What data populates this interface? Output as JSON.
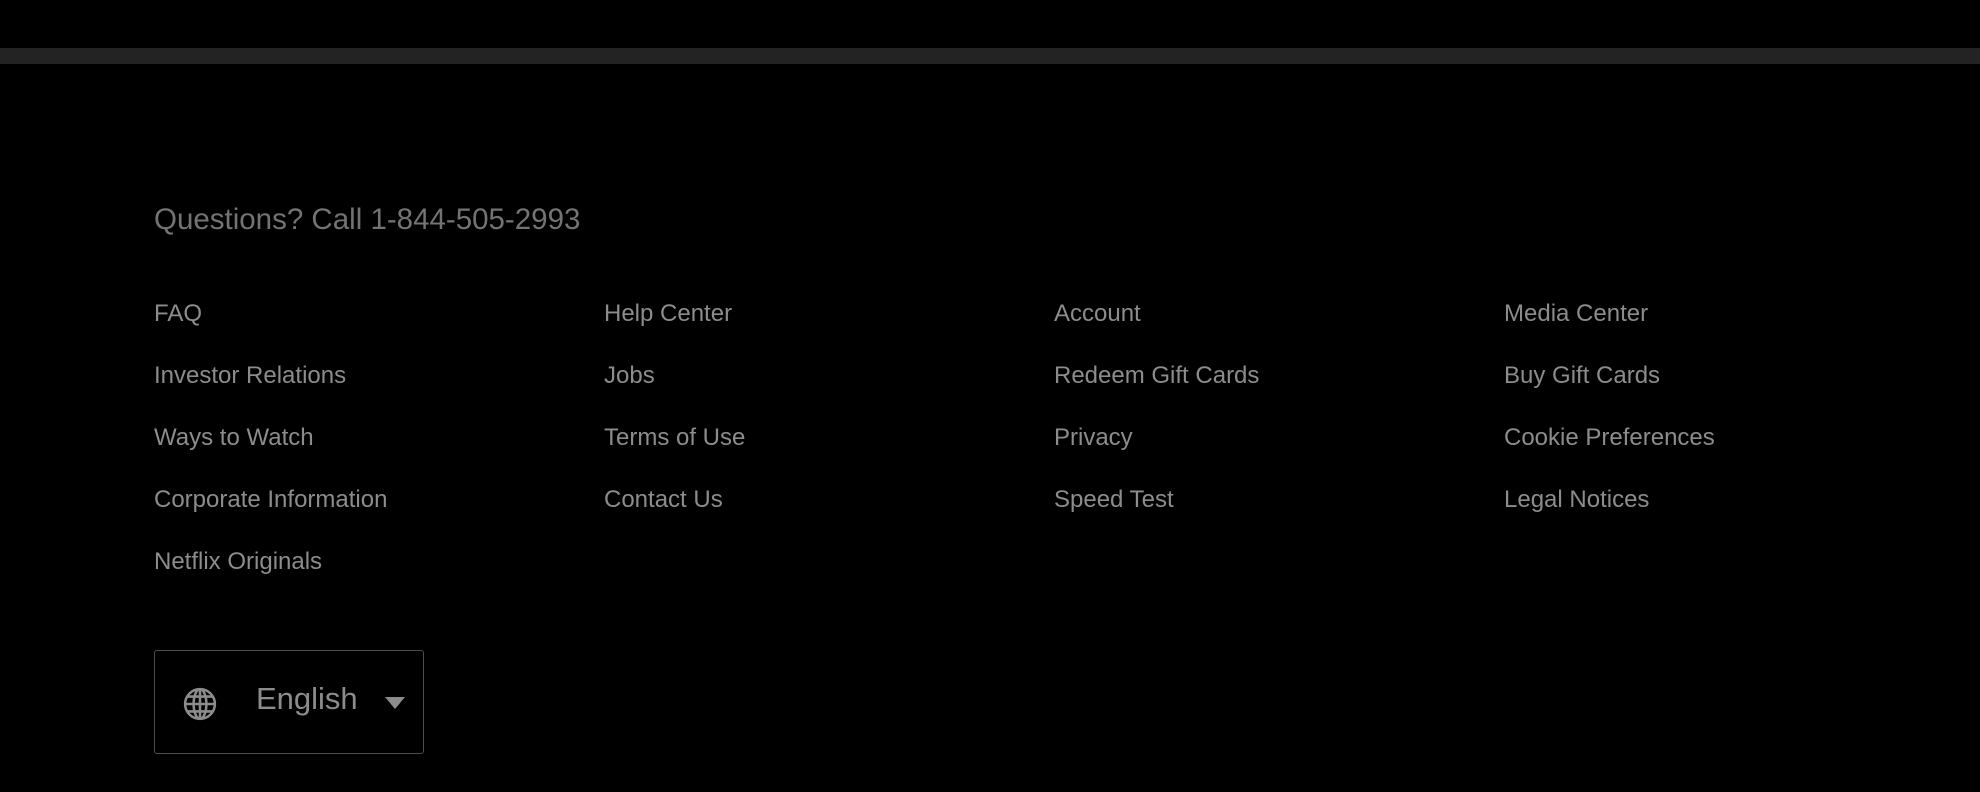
{
  "footer": {
    "contact_text": "Questions? Call 1-844-505-2993",
    "links": [
      "FAQ",
      "Help Center",
      "Account",
      "Media Center",
      "Investor Relations",
      "Jobs",
      "Redeem Gift Cards",
      "Buy Gift Cards",
      "Ways to Watch",
      "Terms of Use",
      "Privacy",
      "Cookie Preferences",
      "Corporate Information",
      "Contact Us",
      "Speed Test",
      "Legal Notices",
      "Netflix Originals"
    ],
    "language": {
      "selected": "English",
      "icon": "globe-icon"
    }
  }
}
